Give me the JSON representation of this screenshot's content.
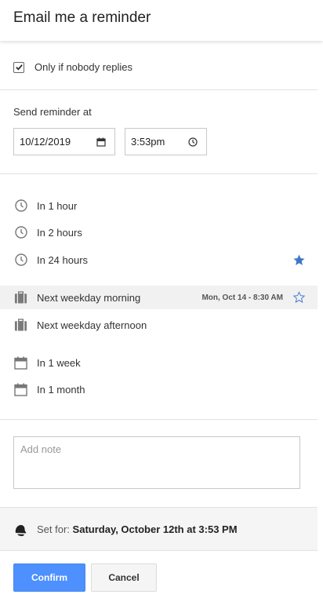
{
  "header": {
    "title": "Email me a reminder"
  },
  "condition": {
    "label": "Only if nobody replies",
    "checked": true
  },
  "send_at": {
    "label": "Send reminder at",
    "date": "10/12/2019",
    "time": "3:53pm"
  },
  "options": [
    {
      "label": "In 1 hour",
      "icon": "clock-icon"
    },
    {
      "label": "In 2 hours",
      "icon": "clock-icon"
    },
    {
      "label": "In 24 hours",
      "icon": "clock-icon",
      "star": "filled",
      "star_color": "#3c78c8"
    },
    {
      "label": "Next weekday morning",
      "icon": "briefcase-icon",
      "detail": "Mon, Oct 14 - 8:30 AM",
      "star": "outline",
      "highlighted": true
    },
    {
      "label": "Next weekday afternoon",
      "icon": "briefcase-icon"
    },
    {
      "label": "In 1 week",
      "icon": "calendar-icon"
    },
    {
      "label": "In 1 month",
      "icon": "calendar-icon"
    }
  ],
  "note": {
    "placeholder": "Add note",
    "value": ""
  },
  "set_for": {
    "prefix": "Set for:",
    "value": "Saturday, October 12th at 3:53 PM"
  },
  "buttons": {
    "confirm": "Confirm",
    "cancel": "Cancel"
  },
  "colors": {
    "accent": "#4d90fe",
    "star": "#3c78c8"
  }
}
